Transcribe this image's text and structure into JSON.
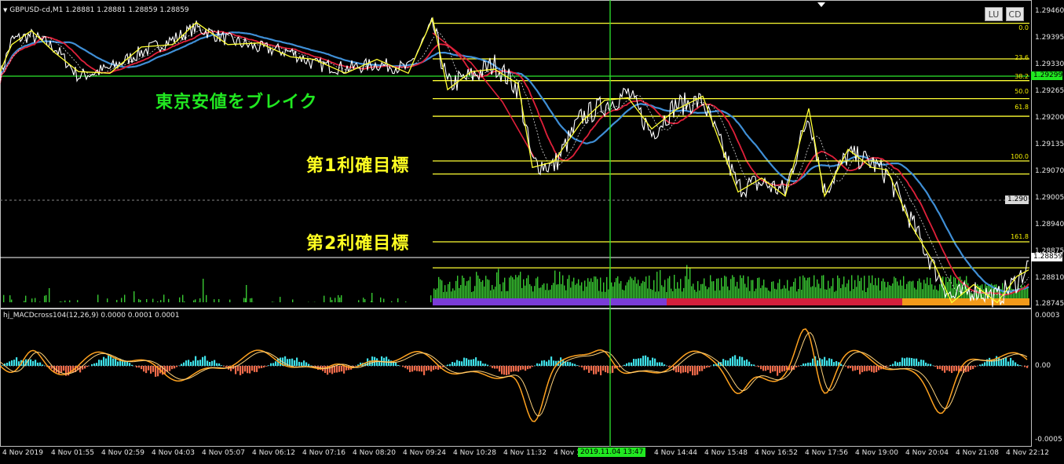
{
  "window": {
    "title": "GBPUSD-cd,M1  1.28881 1.28881 1.28859 1.28859",
    "buttons": [
      "LU",
      "CD"
    ]
  },
  "annotations": {
    "breakout": "東京安値をブレイク",
    "tp1": "第1利確目標",
    "tp2": "第2利確目標"
  },
  "price_axis": [
    "1.29460",
    "1.29395",
    "1.29330",
    "1.29265",
    "1.29200",
    "1.29135",
    "1.29070",
    "1.29005",
    "1.28940",
    "1.28875",
    "1.28810",
    "1.28745"
  ],
  "price_tags": {
    "horizontal_line": "1.29299",
    "dashed_level": "1.290",
    "current_price": "1.28859"
  },
  "fib_levels": [
    {
      "label": "0.0",
      "price": 1.2943
    },
    {
      "label": "23.6",
      "price": 1.29343
    },
    {
      "label": "38.2",
      "price": 1.2929
    },
    {
      "label": "50.0",
      "price": 1.29246
    },
    {
      "label": "61.8",
      "price": 1.29203
    },
    {
      "label": "100.0",
      "price": 1.29062
    },
    {
      "label": "161.8",
      "price": 1.28833
    }
  ],
  "indicator": {
    "title": "hj_MACDcross104(12,26,9) 0.0000 0.0001 0.0001",
    "axis": [
      "0.0003",
      "0.00",
      "-0.0005"
    ]
  },
  "time_axis": [
    "4 Nov 2019",
    "4 Nov 01:55",
    "4 Nov 02:59",
    "4 Nov 04:03",
    "4 Nov 05:07",
    "4 Nov 06:12",
    "4 Nov 07:16",
    "4 Nov 08:20",
    "4 Nov 09:24",
    "4 Nov 10:28",
    "4 Nov 11:32",
    "4 Nov 12:",
    "4 Nov 14:44",
    "4 Nov 15:48",
    "4 Nov 16:52",
    "4 Nov 17:56",
    "4 Nov 19:00",
    "4 Nov 20:04",
    "4 Nov 21:08",
    "4 Nov 22:12"
  ],
  "crosshair_time": "2019.11.04 13:47",
  "colors": {
    "background": "#000000",
    "price_line": "#ffffff",
    "zigzag": "#ffff33",
    "fib": "#ffff33",
    "ma_fast": "#e0203a",
    "ma_slow": "#3f8fd6",
    "volume": "#39c832",
    "crosshair": "#2ee82e",
    "breakout_text": "#21e821",
    "tp_text": "#ffff22",
    "session_purple": "#7a3cd6",
    "session_red": "#d21f3c",
    "session_orange": "#f29a1a",
    "macd_line": "#ffa21f",
    "hist_pos": "#3ee0e8",
    "hist_neg": "#ef6b4b"
  }
}
